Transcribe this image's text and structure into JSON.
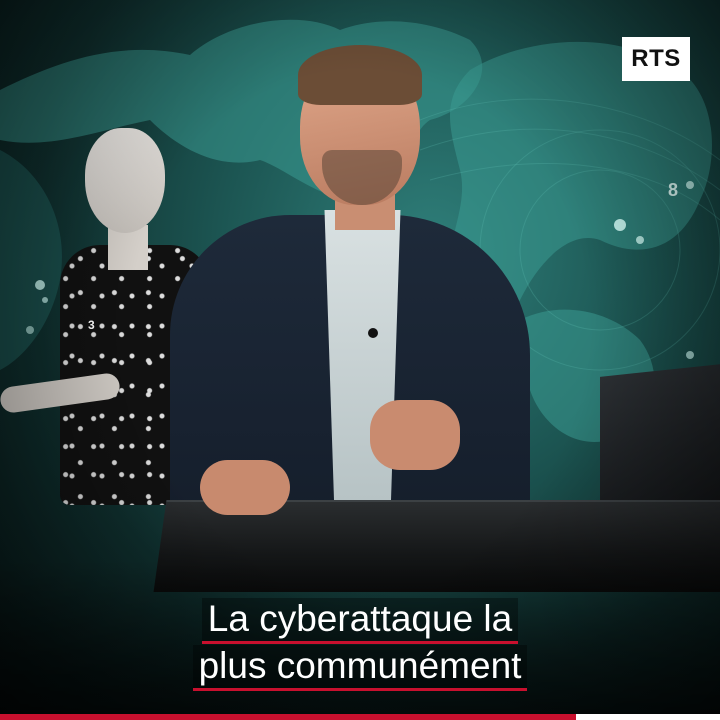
{
  "video": {
    "logo": {
      "text": "RTS"
    },
    "map_number": "8",
    "dress_number": "3",
    "subtitle": {
      "line1": "La cyberattaque la",
      "line2": "plus communément"
    },
    "progress": {
      "fraction": 0.8,
      "fill_color": "#c8102e",
      "track_color": "#ffffff"
    }
  }
}
